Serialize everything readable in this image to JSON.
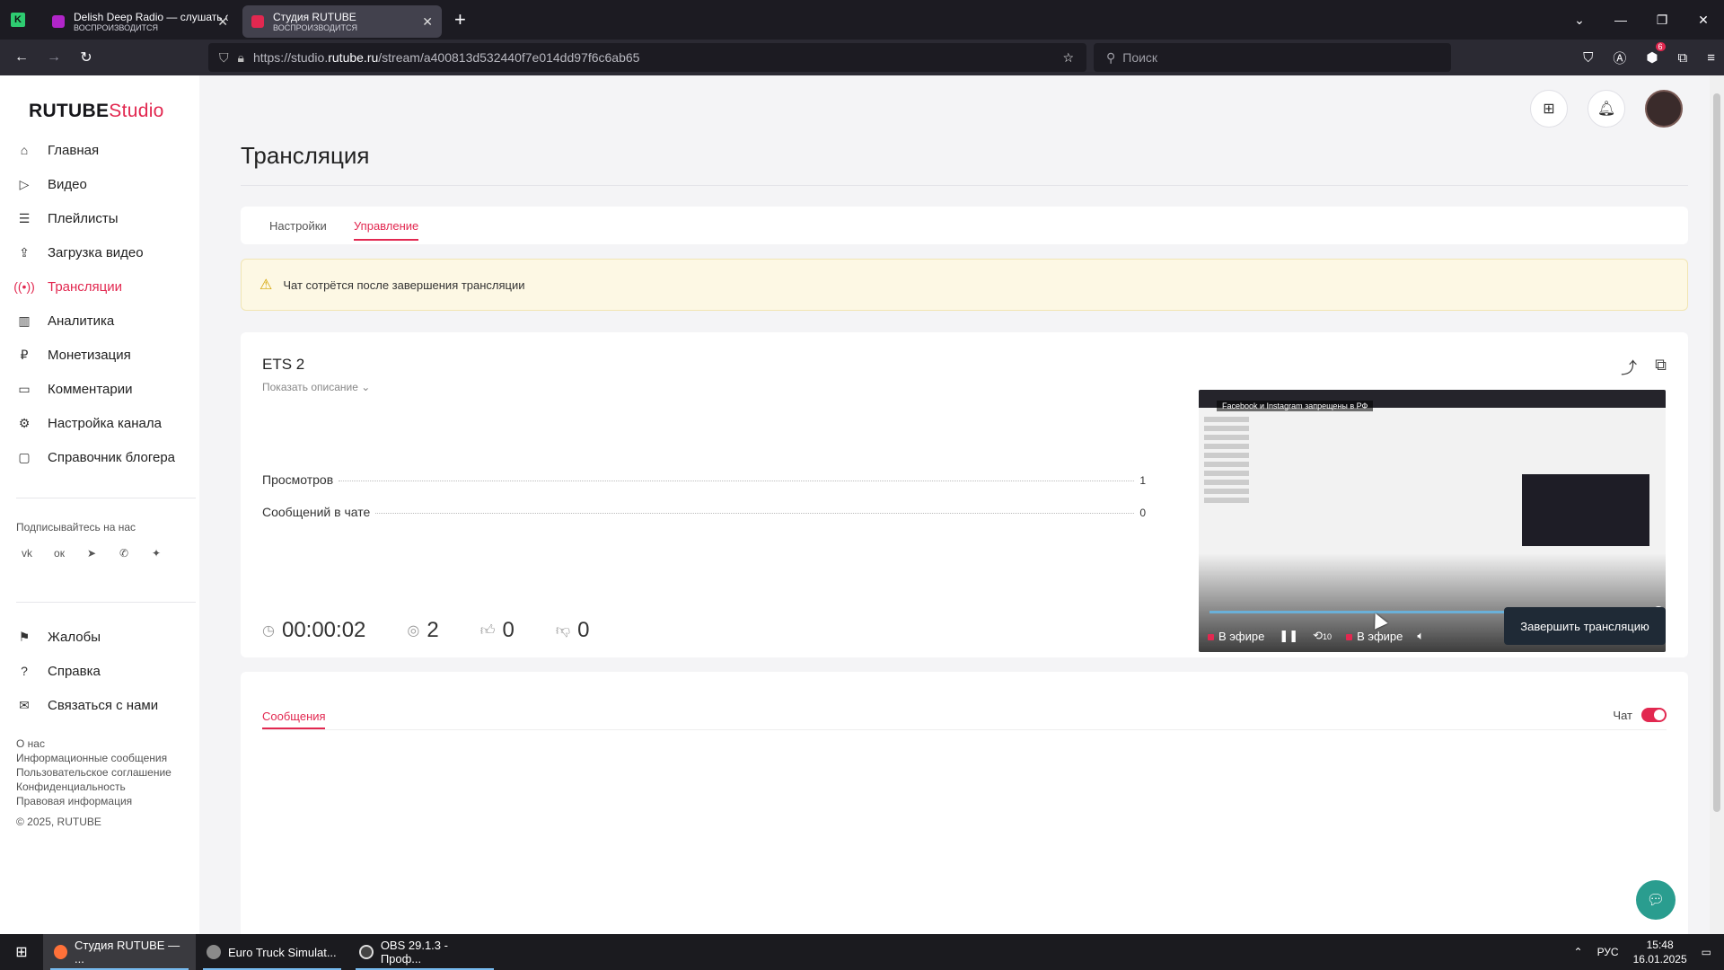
{
  "browser": {
    "tabs": [
      {
        "title": "Delish Deep Radio — слушать о",
        "subtitle": "ВОСПРОИЗВОДИТСЯ",
        "active": false
      },
      {
        "title": "Студия RUTUBE",
        "subtitle": "ВОСПРОИЗВОДИТСЯ",
        "active": true
      }
    ],
    "url_prefix": "https://studio.",
    "url_host": "rutube.ru",
    "url_path": "/stream/a400813d532440f7e014dd97f6c6ab65",
    "search_placeholder": "Поиск",
    "extensions_badge": "6"
  },
  "logo": {
    "brand": "RUTUBE",
    "product": "Studio"
  },
  "sidebar": {
    "items": [
      {
        "label": "Главная",
        "icon": "home-icon",
        "active": false
      },
      {
        "label": "Видео",
        "icon": "video-icon",
        "active": false
      },
      {
        "label": "Плейлисты",
        "icon": "playlist-icon",
        "active": false
      },
      {
        "label": "Загрузка видео",
        "icon": "upload-icon",
        "active": false
      },
      {
        "label": "Трансляции",
        "icon": "broadcast-icon",
        "active": true
      },
      {
        "label": "Аналитика",
        "icon": "analytics-icon",
        "active": false
      },
      {
        "label": "Монетизация",
        "icon": "monetization-icon",
        "active": false
      },
      {
        "label": "Комментарии",
        "icon": "comments-icon",
        "active": false
      },
      {
        "label": "Настройка канала",
        "icon": "gear-icon",
        "active": false
      },
      {
        "label": "Справочник блогера",
        "icon": "guide-icon",
        "active": false
      }
    ],
    "follow_title": "Подписывайтесь на нас",
    "socials": [
      "vk-icon",
      "ok-icon",
      "telegram-icon",
      "viber-icon",
      "plus-icon"
    ],
    "items2": [
      {
        "label": "Жалобы",
        "icon": "flag-icon"
      },
      {
        "label": "Справка",
        "icon": "help-icon"
      },
      {
        "label": "Связаться с нами",
        "icon": "mail-icon"
      }
    ],
    "footer_links": [
      "О нас",
      "Информационные сообщения",
      "Пользовательское соглашение",
      "Конфиденциальность",
      "Правовая информация"
    ],
    "copyright": "© 2025, RUTUBE"
  },
  "page": {
    "title": "Трансляция",
    "tabs": [
      "Настройки",
      "Управление"
    ],
    "active_tab": 1,
    "warning": "Чат сотрётся после завершения трансляции"
  },
  "stream": {
    "title": "ETS 2",
    "show_description": "Показать описание",
    "stats": [
      {
        "label": "Просмотров",
        "value": "1"
      },
      {
        "label": "Сообщений в чате",
        "value": "0"
      }
    ],
    "duration": "00:00:02",
    "viewers": "2",
    "likes": "0",
    "dislikes": "0",
    "end_button": "Завершить трансляцию"
  },
  "player": {
    "notice": "Facebook и Instagram запрещены в РФ",
    "live_label": "В эфире",
    "live_label_2": "В эфире",
    "rewind_label": "10",
    "progress": 1.0
  },
  "messages": {
    "tab": "Сообщения",
    "chat_label": "Чат",
    "chat_enabled": true
  },
  "taskbar": {
    "items": [
      {
        "label": "Студия RUTUBE — ...",
        "active": true
      },
      {
        "label": "Euro Truck Simulat...",
        "active": false
      },
      {
        "label": "OBS 29.1.3 - Проф...",
        "active": false
      }
    ],
    "lang": "РУС",
    "time": "15:48",
    "date": "16.01.2025"
  },
  "colors": {
    "accent": "#e22850",
    "end_button": "#1f2a36",
    "warning_bg": "#fdf8e4"
  }
}
